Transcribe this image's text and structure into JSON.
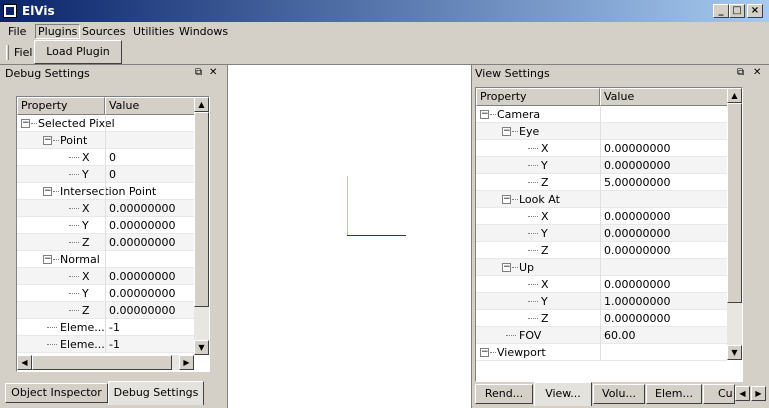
{
  "window": {
    "title": "ElVis"
  },
  "menu": [
    "File",
    "Plugins",
    "Sources",
    "Utilities",
    "Windows"
  ],
  "toolbar": {
    "truncated_label": "Fiel",
    "dropdown_item": "Load Plugin"
  },
  "debug_panel": {
    "title": "Debug Settings",
    "columns": [
      "Property",
      "Value"
    ],
    "rows": [
      {
        "label": "Selected Pixel",
        "value": ""
      },
      {
        "label": "Point",
        "value": ""
      },
      {
        "label": "X",
        "value": "0"
      },
      {
        "label": "Y",
        "value": "0"
      },
      {
        "label": "Intersection Point",
        "value": ""
      },
      {
        "label": "X",
        "value": "0.00000000"
      },
      {
        "label": "Y",
        "value": "0.00000000"
      },
      {
        "label": "Z",
        "value": "0.00000000"
      },
      {
        "label": "Normal",
        "value": ""
      },
      {
        "label": "X",
        "value": "0.00000000"
      },
      {
        "label": "Y",
        "value": "0.00000000"
      },
      {
        "label": "Z",
        "value": "0.00000000"
      },
      {
        "label": "Eleme...",
        "value": "-1"
      },
      {
        "label": "Eleme...",
        "value": "-1"
      }
    ],
    "tabs": [
      "Object Inspector",
      "Debug Settings"
    ]
  },
  "view_panel": {
    "title": "View Settings",
    "columns": [
      "Property",
      "Value"
    ],
    "rows": [
      {
        "label": "Camera",
        "value": ""
      },
      {
        "label": "Eye",
        "value": ""
      },
      {
        "label": "X",
        "value": "0.00000000"
      },
      {
        "label": "Y",
        "value": "0.00000000"
      },
      {
        "label": "Z",
        "value": "5.00000000"
      },
      {
        "label": "Look At",
        "value": ""
      },
      {
        "label": "X",
        "value": "0.00000000"
      },
      {
        "label": "Y",
        "value": "0.00000000"
      },
      {
        "label": "Z",
        "value": "0.00000000"
      },
      {
        "label": "Up",
        "value": ""
      },
      {
        "label": "X",
        "value": "0.00000000"
      },
      {
        "label": "Y",
        "value": "1.00000000"
      },
      {
        "label": "Z",
        "value": "0.00000000"
      },
      {
        "label": "FOV",
        "value": "60.00"
      },
      {
        "label": "Viewport",
        "value": ""
      }
    ],
    "tabs": [
      "Rend...",
      "View...",
      "Volu...",
      "Elem...",
      "Cu"
    ]
  },
  "viewport": {
    "axis_y_color": "#e8d400",
    "axis_x_color": "#b00000"
  },
  "icons": {
    "restore": "restore-icon",
    "close": "close-icon"
  }
}
